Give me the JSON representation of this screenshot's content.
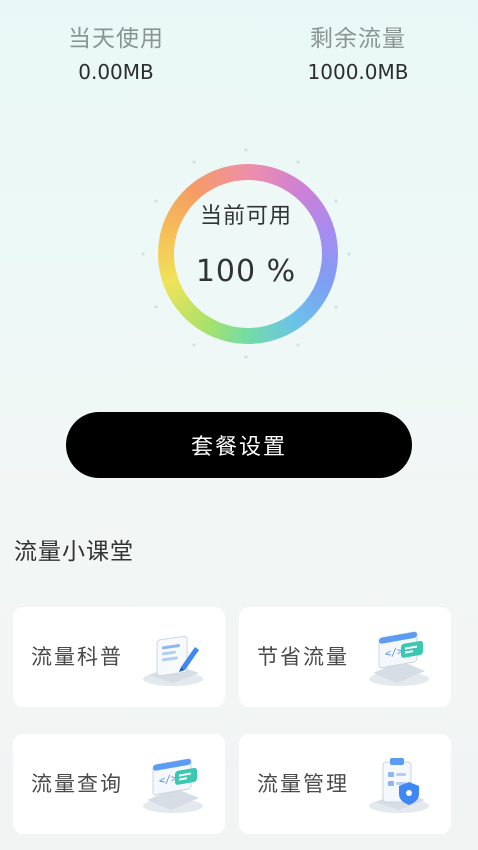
{
  "stats": {
    "today_label": "当天使用",
    "today_value": "0.00MB",
    "remaining_label": "剩余流量",
    "remaining_value": "1000.0MB"
  },
  "gauge": {
    "label": "当前可用",
    "value": "100 %",
    "percent": 100
  },
  "plan_button_label": "套餐设置",
  "section_title": "流量小课堂",
  "cards": [
    {
      "label": "流量科普",
      "icon": "document-pen-icon"
    },
    {
      "label": "节省流量",
      "icon": "code-window-icon"
    },
    {
      "label": "流量查询",
      "icon": "code-window-icon"
    },
    {
      "label": "流量管理",
      "icon": "clipboard-shield-icon"
    }
  ]
}
